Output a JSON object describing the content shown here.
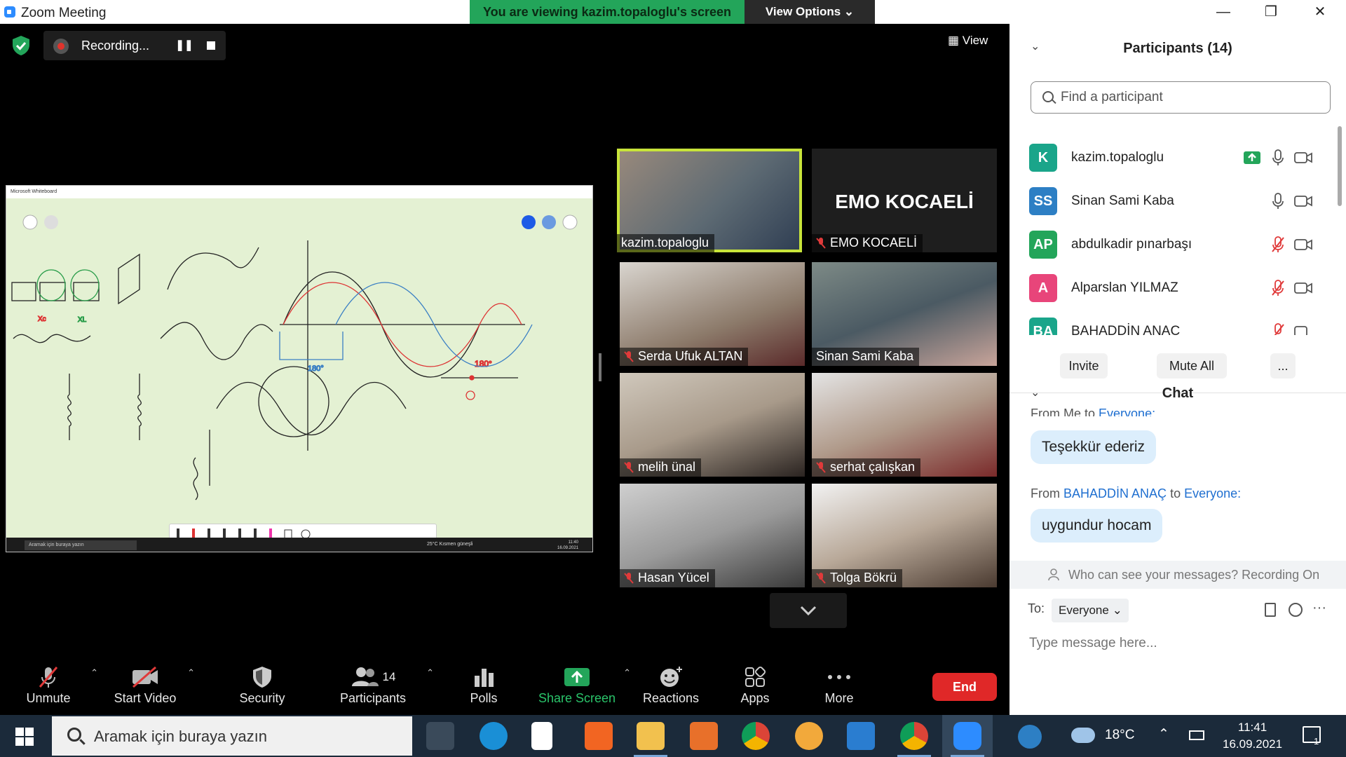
{
  "app": {
    "title": "Zoom Meeting"
  },
  "share_banner": {
    "text": "You are viewing kazim.topaloglu's screen",
    "options_label": "View Options"
  },
  "recording": {
    "label": "Recording..."
  },
  "view": {
    "label": "View"
  },
  "whiteboard": {
    "title": "Microsoft Whiteboard",
    "taskbar_search": "Aramak için buraya yazın",
    "weather": "25°C  Kısmen güneşli",
    "time": "11:40",
    "date": "16.09.2021"
  },
  "tiles": [
    {
      "name": "kazim.topaloglu",
      "muted": false,
      "active": true
    },
    {
      "name": "EMO KOCAELİ",
      "muted": true,
      "logo_text": "EMO KOCAELİ"
    },
    {
      "name": "Serda Ufuk ALTAN",
      "muted": true
    },
    {
      "name": "Sinan Sami Kaba",
      "muted": false
    },
    {
      "name": "melih ünal",
      "muted": true
    },
    {
      "name": "serhat çalışkan",
      "muted": true
    },
    {
      "name": "Hasan Yücel",
      "muted": true
    },
    {
      "name": "Tolga Bökrü",
      "muted": true
    }
  ],
  "controls": {
    "unmute": "Unmute",
    "start_video": "Start Video",
    "security": "Security",
    "participants": "Participants",
    "participants_count": "14",
    "polls": "Polls",
    "share_screen": "Share Screen",
    "reactions": "Reactions",
    "apps": "Apps",
    "more": "More",
    "end": "End"
  },
  "participants_panel": {
    "title": "Participants (14)",
    "search_placeholder": "Find a participant",
    "people": [
      {
        "initials": "K",
        "name": "kazim.topaloglu",
        "color": "#1aa58a",
        "sharing": true,
        "mic_on": true
      },
      {
        "initials": "SS",
        "name": "Sinan Sami Kaba",
        "color": "#2d7fc4",
        "sharing": false,
        "mic_on": true
      },
      {
        "initials": "AP",
        "name": "abdulkadir pınarbaşı",
        "color": "#23a55a",
        "sharing": false,
        "mic_on": false
      },
      {
        "initials": "A",
        "name": "Alparslan YILMAZ",
        "color": "#e8457a",
        "sharing": false,
        "mic_on": false
      },
      {
        "initials": "BA",
        "name": "BAHADDİN ANAÇ",
        "color": "#1aa58a",
        "sharing": false,
        "mic_on": false
      }
    ],
    "invite": "Invite",
    "mute_all": "Mute All",
    "more": "..."
  },
  "chat": {
    "title": "Chat",
    "from_me": "From Me to",
    "everyone": "Everyone:",
    "msg1": "Teşekkür ederiz",
    "from2_prefix": "From",
    "from2_name": "BAHADDİN ANAÇ",
    "from2_to": "to",
    "msg2": "uygundur hocam",
    "notice": "Who can see your messages? Recording On",
    "to_label": "To:",
    "to_value": "Everyone",
    "input_placeholder": "Type message here..."
  },
  "taskbar": {
    "search": "Aramak için buraya yazın",
    "temp": "18°C",
    "time": "11:41",
    "date": "16.09.2021",
    "notif": "1"
  },
  "colors": {
    "accent_green": "#23a55a",
    "end_red": "#e02828",
    "zoom_blue": "#2d8cff"
  }
}
